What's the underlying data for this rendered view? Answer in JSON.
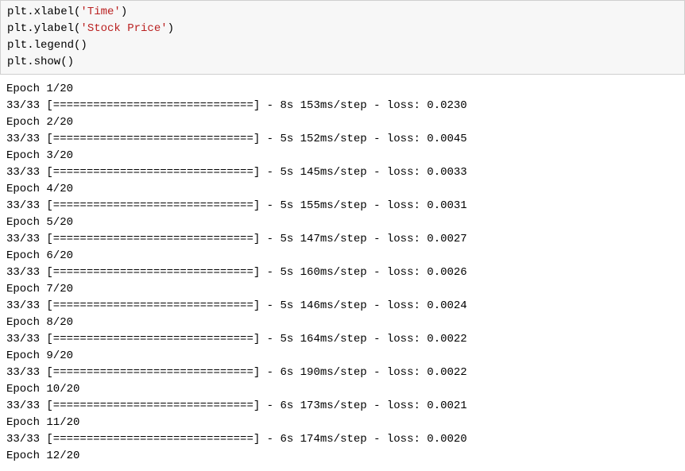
{
  "code": {
    "line1_prefix": "plt.xlabel(",
    "line1_str": "'Time'",
    "line1_suffix": ")",
    "line2_prefix": "plt.ylabel(",
    "line2_str": "'Stock Price'",
    "line2_suffix": ")",
    "line3": "plt.legend()",
    "line4": "plt.show()"
  },
  "output": {
    "epochs": [
      {
        "header": "Epoch 1/20",
        "progress": "33/33 [==============================] - 8s 153ms/step - loss: 0.0230"
      },
      {
        "header": "Epoch 2/20",
        "progress": "33/33 [==============================] - 5s 152ms/step - loss: 0.0045"
      },
      {
        "header": "Epoch 3/20",
        "progress": "33/33 [==============================] - 5s 145ms/step - loss: 0.0033"
      },
      {
        "header": "Epoch 4/20",
        "progress": "33/33 [==============================] - 5s 155ms/step - loss: 0.0031"
      },
      {
        "header": "Epoch 5/20",
        "progress": "33/33 [==============================] - 5s 147ms/step - loss: 0.0027"
      },
      {
        "header": "Epoch 6/20",
        "progress": "33/33 [==============================] - 5s 160ms/step - loss: 0.0026"
      },
      {
        "header": "Epoch 7/20",
        "progress": "33/33 [==============================] - 5s 146ms/step - loss: 0.0024"
      },
      {
        "header": "Epoch 8/20",
        "progress": "33/33 [==============================] - 5s 164ms/step - loss: 0.0022"
      },
      {
        "header": "Epoch 9/20",
        "progress": "33/33 [==============================] - 6s 190ms/step - loss: 0.0022"
      },
      {
        "header": "Epoch 10/20",
        "progress": "33/33 [==============================] - 6s 173ms/step - loss: 0.0021"
      },
      {
        "header": "Epoch 11/20",
        "progress": "33/33 [==============================] - 6s 174ms/step - loss: 0.0020"
      },
      {
        "header": "Epoch 12/20",
        "progress": ""
      }
    ]
  }
}
